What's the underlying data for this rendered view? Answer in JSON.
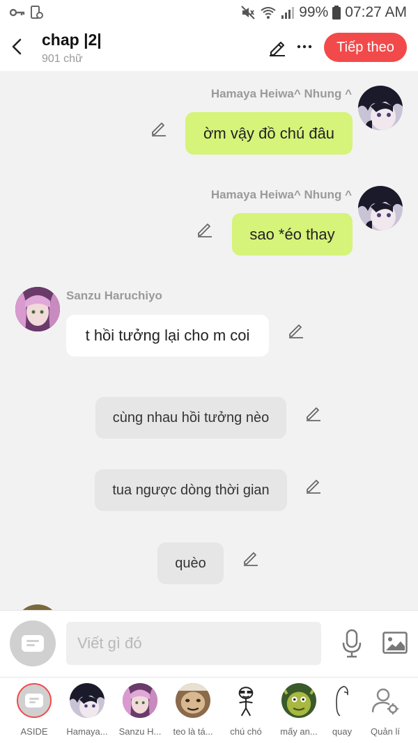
{
  "status": {
    "battery_pct": "99%",
    "time": "07:27 AM"
  },
  "header": {
    "title": "chap |2|",
    "word_count": "901 chữ",
    "next_button": "Tiếp theo"
  },
  "messages": [
    {
      "sender": "Hamaya Heiwa^ Nhung ^",
      "text": "ờm vậy đồ chú đâu",
      "side": "right"
    },
    {
      "sender": "Hamaya Heiwa^ Nhung ^",
      "text": "sao *éo thay",
      "side": "right"
    },
    {
      "sender": "Sanzu Haruchiyo",
      "text": "t hồi tưởng lại cho m coi",
      "side": "left"
    },
    {
      "text": "cùng nhau hồi tưởng nèo",
      "side": "narration"
    },
    {
      "text": "tua ngược dòng thời gian",
      "side": "narration"
    },
    {
      "text": "quèo",
      "side": "narration"
    }
  ],
  "composer": {
    "placeholder": "Viết gì đó"
  },
  "characters": [
    {
      "label": "ASIDE",
      "icon": "aside-icon",
      "selected": true
    },
    {
      "label": "Hamaya...",
      "icon": "avatar-hamaya"
    },
    {
      "label": "Sanzu H...",
      "icon": "avatar-sanzu"
    },
    {
      "label": "teo là tá...",
      "icon": "avatar-teo"
    },
    {
      "label": "chú chó",
      "icon": "avatar-chu-cho"
    },
    {
      "label": "mấy an...",
      "icon": "avatar-may-an"
    },
    {
      "label": "quay",
      "icon": "avatar-quay"
    },
    {
      "label": "Quản lí",
      "icon": "manage-user-icon"
    }
  ],
  "colors": {
    "accent": "#f24a4a",
    "my_bubble": "#d6f37a",
    "other_bubble": "#ffffff",
    "narration_bubble": "#e6e6e6"
  }
}
